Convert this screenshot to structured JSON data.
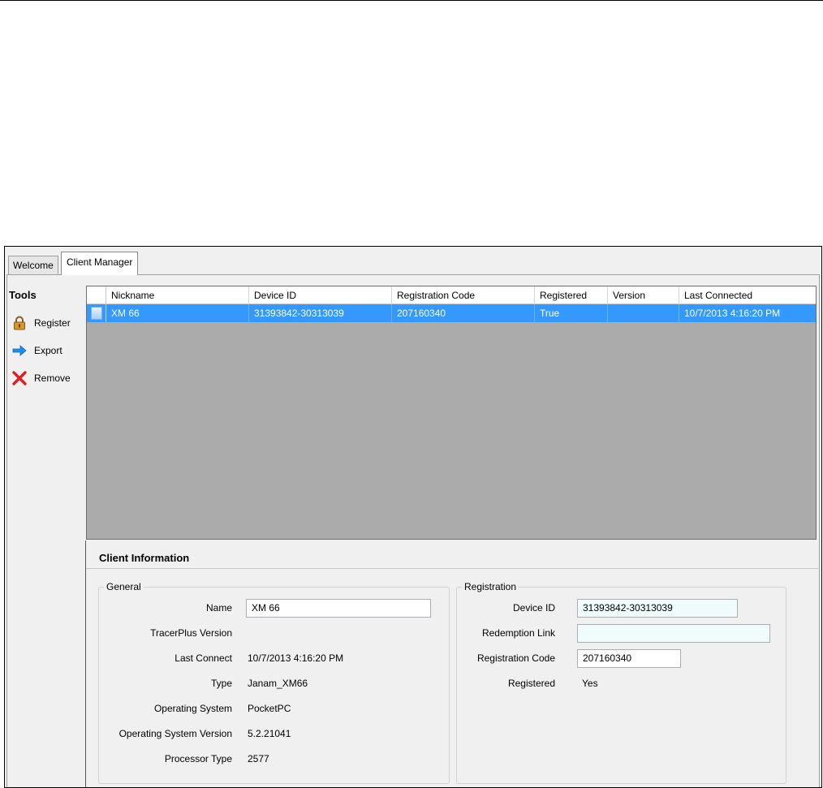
{
  "tabs": [
    {
      "label": "Welcome",
      "active": false
    },
    {
      "label": "Client Manager",
      "active": true
    }
  ],
  "tools": {
    "title": "Tools",
    "items": [
      {
        "label": "Register",
        "icon": "lock-icon"
      },
      {
        "label": "Export",
        "icon": "arrow-right-icon"
      },
      {
        "label": "Remove",
        "icon": "red-x-icon"
      }
    ]
  },
  "grid": {
    "columns": [
      "Nickname",
      "Device ID",
      "Registration Code",
      "Registered",
      "Version",
      "Last Connected"
    ],
    "rows": [
      {
        "nickname": "XM 66",
        "device_id": "31393842-30313039",
        "registration_code": "207160340",
        "registered": "True",
        "version": "",
        "last_connected": "10/7/2013 4:16:20 PM",
        "selected": true
      }
    ]
  },
  "client_info": {
    "title": "Client Information",
    "general": {
      "title": "General",
      "name_label": "Name",
      "name_value": "XM 66",
      "tracerplus_version_label": "TracerPlus Version",
      "tracerplus_version_value": "",
      "last_connect_label": "Last Connect",
      "last_connect_value": "10/7/2013 4:16:20 PM",
      "type_label": "Type",
      "type_value": "Janam_XM66",
      "os_label": "Operating System",
      "os_value": "PocketPC",
      "os_version_label": "Operating System Version",
      "os_version_value": "5.2.21041",
      "processor_label": "Processor Type",
      "processor_value": "2577"
    },
    "registration": {
      "title": "Registration",
      "device_id_label": "Device ID",
      "device_id_value": "31393842-30313039",
      "redemption_link_label": "Redemption Link",
      "redemption_link_value": "",
      "registration_code_label": "Registration Code",
      "registration_code_value": "207160340",
      "registered_label": "Registered",
      "registered_value": "Yes"
    }
  },
  "colors": {
    "selection": "#3399ff",
    "grid_background": "#ababab",
    "window_background": "#f0f0f0"
  }
}
